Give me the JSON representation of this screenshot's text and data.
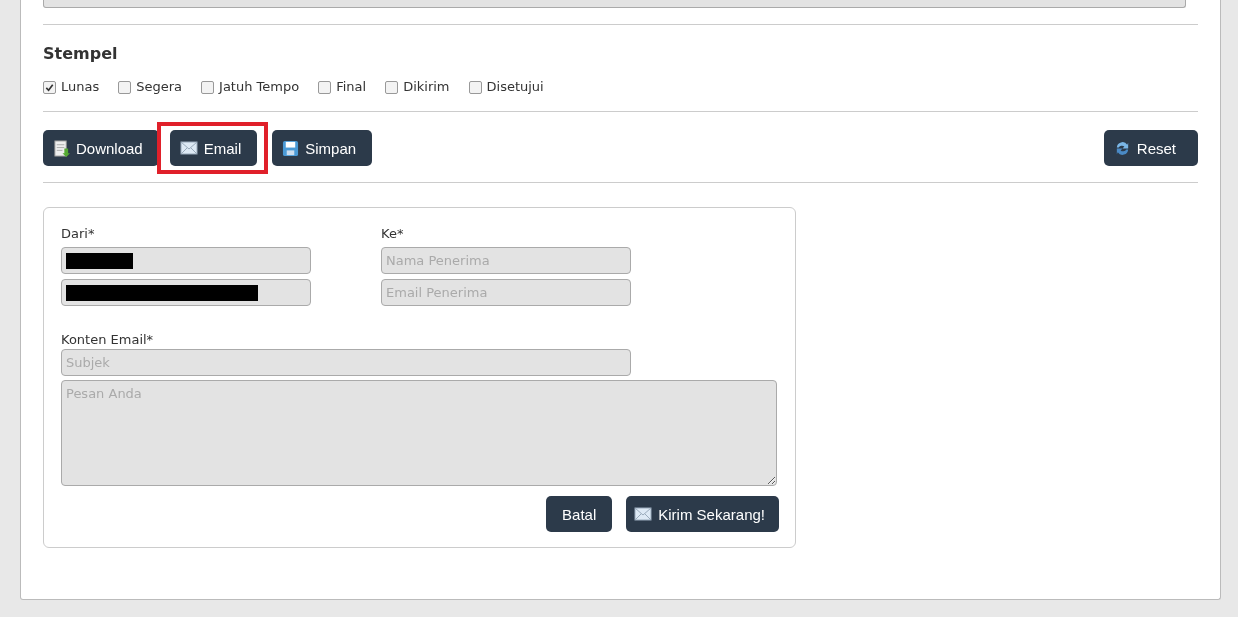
{
  "stamp": {
    "title": "Stempel",
    "options": [
      {
        "label": "Lunas",
        "checked": true
      },
      {
        "label": "Segera",
        "checked": false
      },
      {
        "label": "Jatuh Tempo",
        "checked": false
      },
      {
        "label": "Final",
        "checked": false
      },
      {
        "label": "Dikirim",
        "checked": false
      },
      {
        "label": "Disetujui",
        "checked": false
      }
    ]
  },
  "actions": [
    {
      "label": "Download",
      "kind": "download",
      "highlighted": false
    },
    {
      "label": "Email",
      "kind": "email",
      "highlighted": true
    },
    {
      "label": "Simpan",
      "kind": "save",
      "highlighted": false
    }
  ],
  "reset": {
    "label": "Reset"
  },
  "email_form": {
    "from_label": "Dari*",
    "from_fields": [
      {
        "redacted": true
      },
      {
        "redacted": true
      }
    ],
    "to_label": "Ke*",
    "to_fields": [
      {
        "placeholder": "Nama Penerima"
      },
      {
        "placeholder": "Email Penerima"
      }
    ],
    "content_label": "Konten Email*",
    "subject": {
      "placeholder": "Subjek"
    },
    "message": {
      "placeholder": "Pesan Anda"
    },
    "cancel": "Batal",
    "send": "Kirim Sekarang!"
  }
}
